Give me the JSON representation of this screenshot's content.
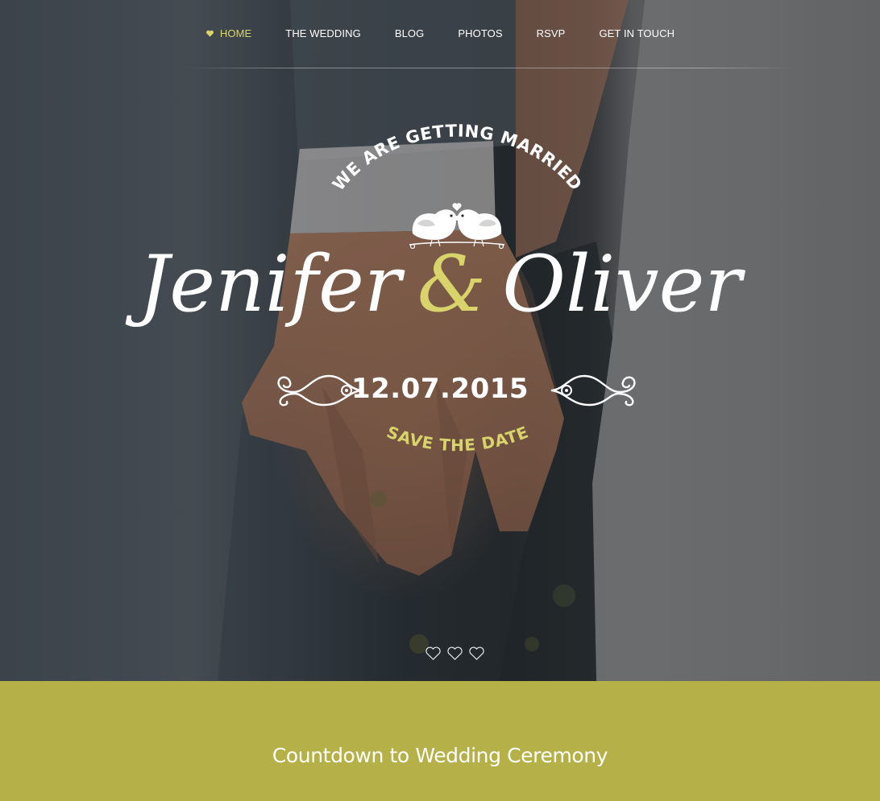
{
  "nav": {
    "items": [
      {
        "label": "HOME",
        "active": true
      },
      {
        "label": "THE WEDDING",
        "active": false
      },
      {
        "label": "BLOG",
        "active": false
      },
      {
        "label": "PHOTOS",
        "active": false
      },
      {
        "label": "RSVP",
        "active": false
      },
      {
        "label": "GET IN TOUCH",
        "active": false
      }
    ],
    "active_icon": "heart-icon"
  },
  "hero": {
    "tagline": "WE ARE GETTING MARRIED",
    "bride": "Jenifer",
    "ampersand": "&",
    "groom": "Oliver",
    "date": "12.07.2015",
    "subtitle": "SAVE THE DATE",
    "decor_icon": "love-birds-icon",
    "slider_dots": 3
  },
  "countdown": {
    "title": "Countdown to Wedding Ceremony"
  },
  "colors": {
    "accent": "#d9d36b",
    "band": "#b5b047",
    "text_light": "#ffffff"
  }
}
